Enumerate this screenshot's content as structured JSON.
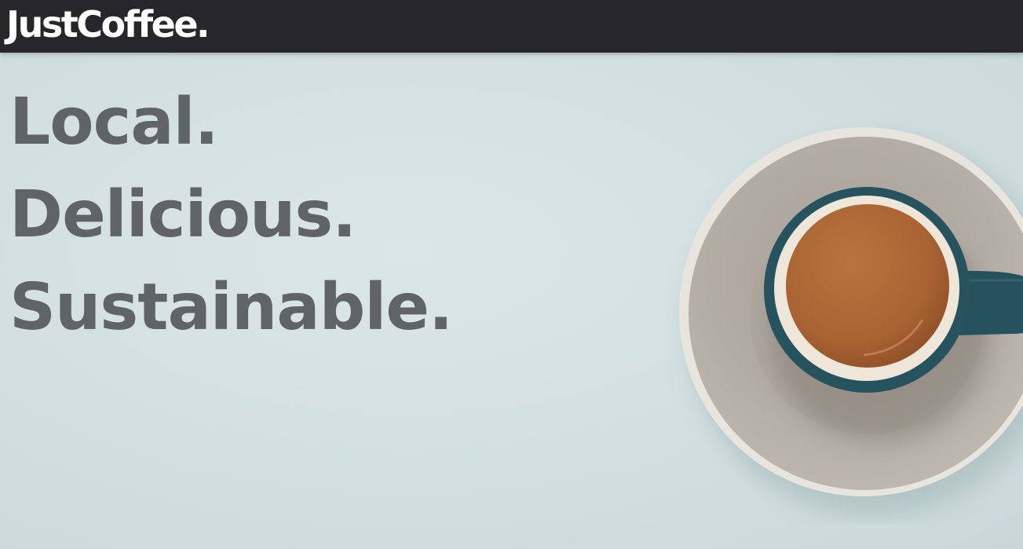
{
  "header": {
    "logo_text": "JustCoffee."
  },
  "hero": {
    "lines": [
      "Local.",
      "Delicious.",
      "Sustainable."
    ]
  },
  "colors": {
    "header_bg": "#26262b",
    "hero_bg": "#d4e0e1",
    "tagline_text": "#616466",
    "saucer": "#b3aca4",
    "cup": "#25535f",
    "coffee": "#b36d3e"
  },
  "icons": {
    "coffee_cup": "coffee-cup-icon"
  }
}
